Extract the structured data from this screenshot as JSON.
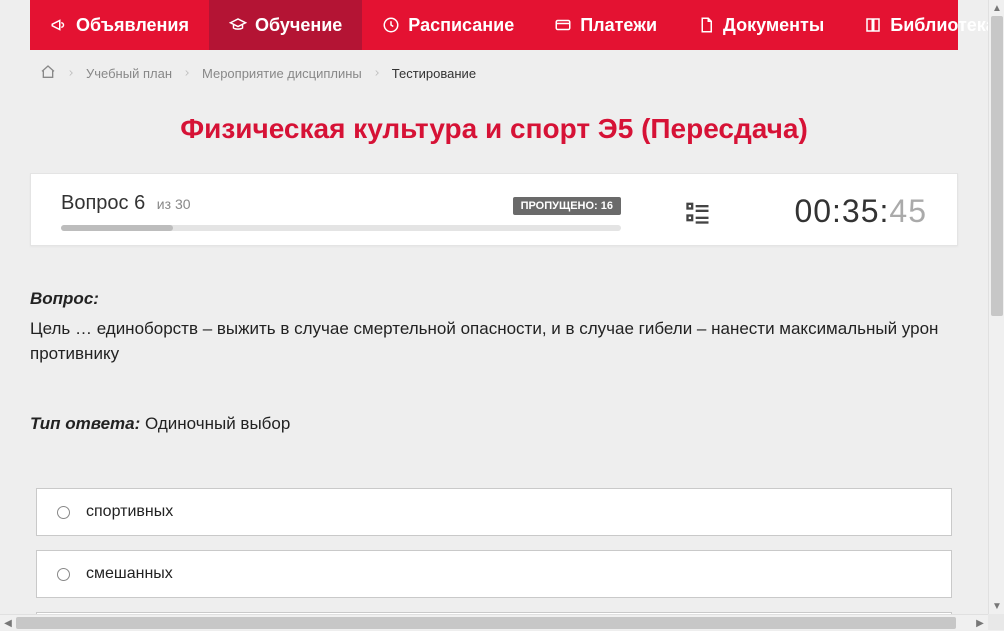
{
  "nav": {
    "items": [
      {
        "icon": "megaphone",
        "label": "Объявления"
      },
      {
        "icon": "gradcap",
        "label": "Обучение",
        "active": true
      },
      {
        "icon": "clock",
        "label": "Расписание"
      },
      {
        "icon": "card",
        "label": "Платежи"
      },
      {
        "icon": "doc",
        "label": "Документы"
      },
      {
        "icon": "book",
        "label": "Библиотека",
        "chevron": true
      }
    ]
  },
  "breadcrumb": {
    "home_label": "home",
    "items": [
      "Учебный план",
      "Мероприятие дисциплины"
    ],
    "current": "Тестирование"
  },
  "title": "Физическая культура и спорт Э5 (Пересдача)",
  "status": {
    "question_prefix": "Вопрос ",
    "question_num": "6",
    "of_prefix": "из ",
    "total": "30",
    "skipped_label": "ПРОПУЩЕНО: ",
    "skipped_count": "16",
    "progress_percent": 20
  },
  "timer": {
    "mm": "00",
    "ss": "35",
    "cs": "45"
  },
  "question": {
    "label": "Вопрос:",
    "text": "Цель … единоборств – выжить в случае смертельной опасности, и в случае гибели – нанести максимальный урон противнику"
  },
  "answer_type": {
    "label": "Тип ответа:",
    "value": "Одиночный выбор"
  },
  "options": [
    "спортивных",
    "смешанных"
  ]
}
